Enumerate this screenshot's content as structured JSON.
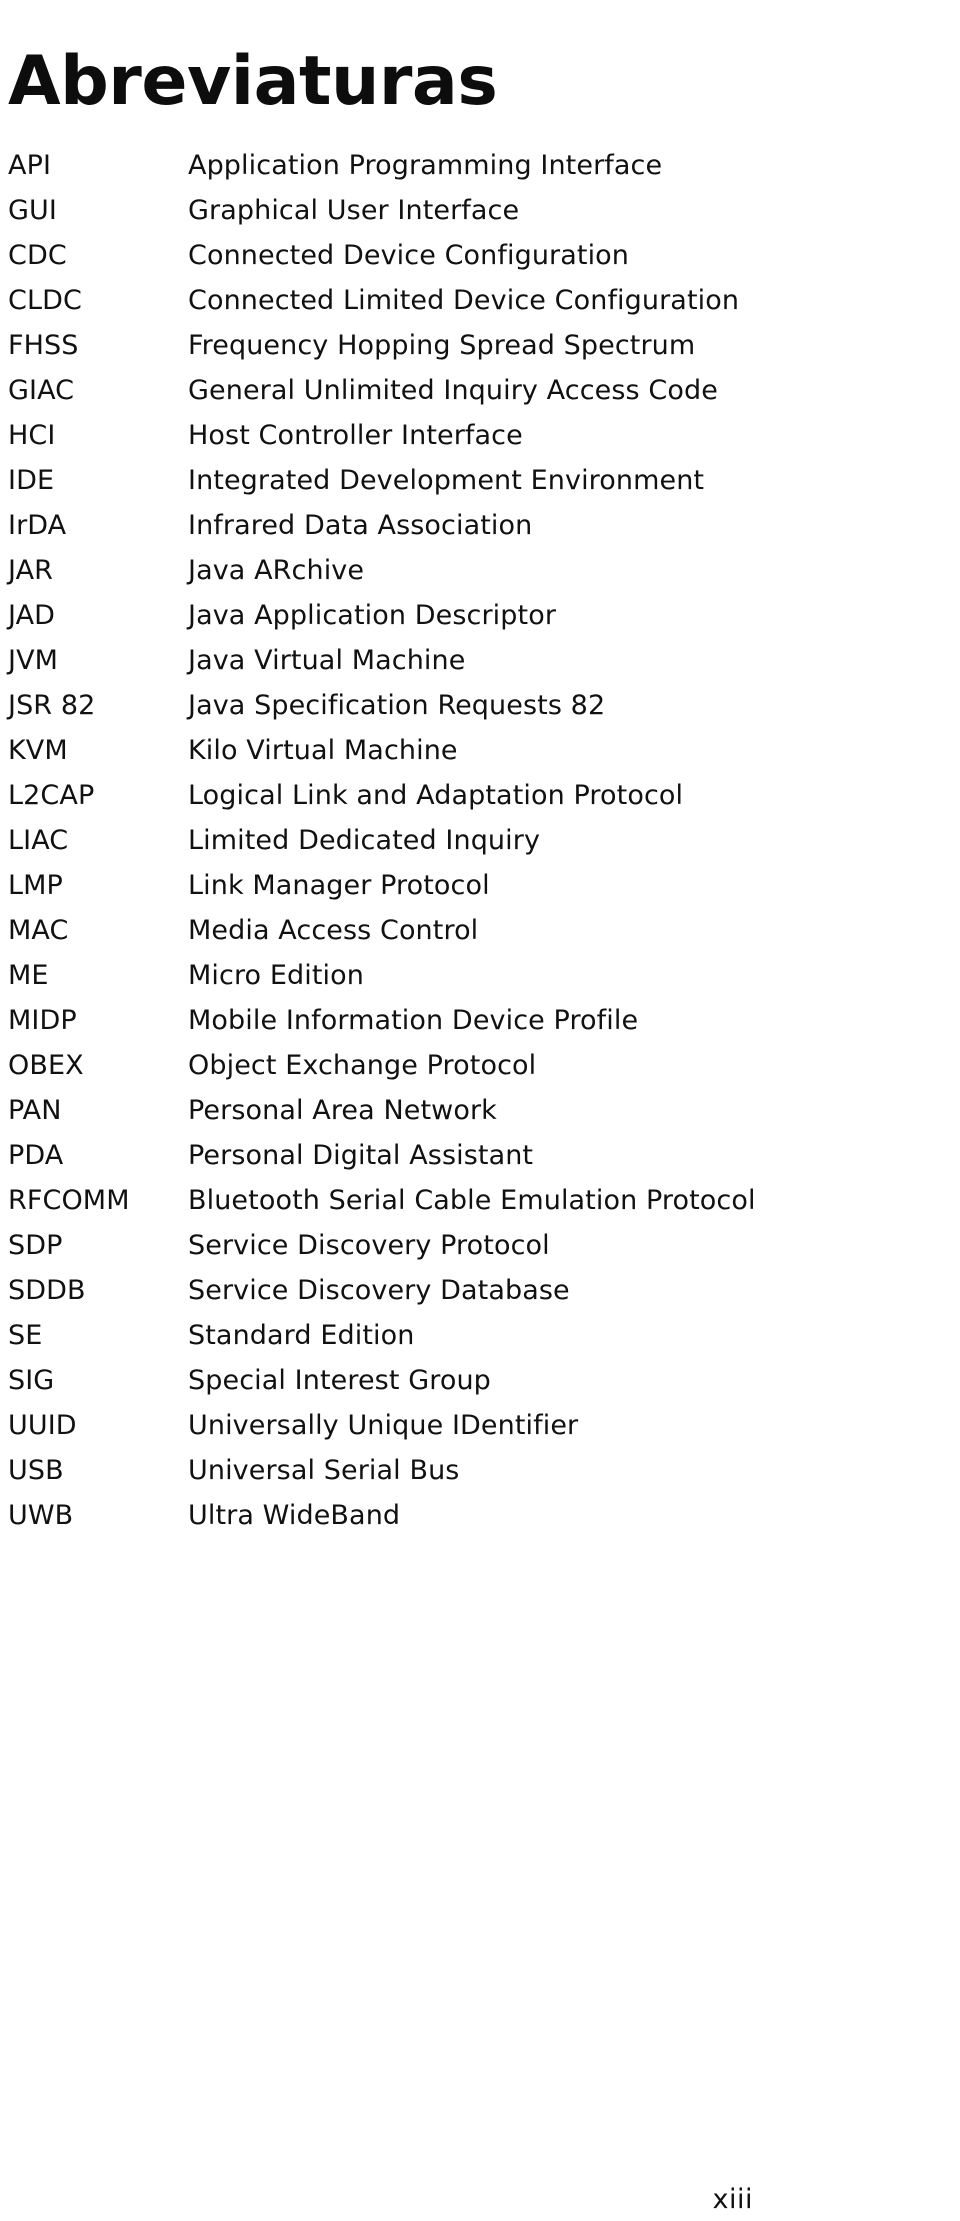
{
  "document": {
    "title": "Abreviaturas",
    "page_number": "xiii"
  },
  "abbreviations": [
    {
      "term": "API",
      "definition": "Application Programming Interface"
    },
    {
      "term": "GUI",
      "definition": "Graphical User Interface"
    },
    {
      "term": "CDC",
      "definition": "Connected Device Configuration"
    },
    {
      "term": "CLDC",
      "definition": "Connected Limited Device Configuration"
    },
    {
      "term": "FHSS",
      "definition": "Frequency Hopping Spread Spectrum"
    },
    {
      "term": "GIAC",
      "definition": "General Unlimited Inquiry Access Code"
    },
    {
      "term": "HCI",
      "definition": "Host Controller Interface"
    },
    {
      "term": "IDE",
      "definition": "Integrated Development Environment"
    },
    {
      "term": "IrDA",
      "definition": "Infrared Data Association"
    },
    {
      "term": "JAR",
      "definition": "Java ARchive"
    },
    {
      "term": "JAD",
      "definition": "Java Application Descriptor"
    },
    {
      "term": "JVM",
      "definition": "Java Virtual Machine"
    },
    {
      "term": "JSR 82",
      "definition": "Java Specification Requests 82"
    },
    {
      "term": "KVM",
      "definition": "Kilo Virtual Machine"
    },
    {
      "term": "L2CAP",
      "definition": "Logical Link and Adaptation Protocol"
    },
    {
      "term": "LIAC",
      "definition": "Limited Dedicated Inquiry"
    },
    {
      "term": "LMP",
      "definition": "Link Manager Protocol"
    },
    {
      "term": "MAC",
      "definition": "Media Access Control"
    },
    {
      "term": "ME",
      "definition": "Micro Edition"
    },
    {
      "term": "MIDP",
      "definition": "Mobile Information Device Profile"
    },
    {
      "term": "OBEX",
      "definition": "Object Exchange Protocol"
    },
    {
      "term": "PAN",
      "definition": "Personal Area Network"
    },
    {
      "term": "PDA",
      "definition": "Personal Digital Assistant"
    },
    {
      "term": "RFCOMM",
      "definition": "Bluetooth Serial Cable Emulation Protocol"
    },
    {
      "term": "SDP",
      "definition": "Service Discovery Protocol"
    },
    {
      "term": "SDDB",
      "definition": "Service Discovery Database"
    },
    {
      "term": "SE",
      "definition": "Standard Edition"
    },
    {
      "term": "SIG",
      "definition": "Special Interest Group"
    },
    {
      "term": "UUID",
      "definition": "Universally Unique IDentifier"
    },
    {
      "term": "USB",
      "definition": "Universal Serial Bus"
    },
    {
      "term": "UWB",
      "definition": "Ultra WideBand"
    }
  ]
}
